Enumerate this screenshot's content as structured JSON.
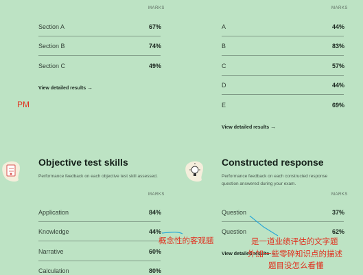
{
  "marks_label": "MARKS",
  "sections_top": {
    "rows": [
      {
        "label": "Section A",
        "value": "67%"
      },
      {
        "label": "Section B",
        "value": "74%"
      },
      {
        "label": "Section C",
        "value": "49%"
      }
    ],
    "link": "View detailed results"
  },
  "letters_top": {
    "rows": [
      {
        "label": "A",
        "value": "44%"
      },
      {
        "label": "B",
        "value": "83%"
      },
      {
        "label": "C",
        "value": "57%"
      },
      {
        "label": "D",
        "value": "44%"
      },
      {
        "label": "E",
        "value": "69%"
      }
    ],
    "link": "View detailed results"
  },
  "objective": {
    "title": "Objective test skills",
    "description": "Performance feedback on each objective test skill assessed.",
    "rows": [
      {
        "label": "Application",
        "value": "84%"
      },
      {
        "label": "Knowledge",
        "value": "44%"
      },
      {
        "label": "Narrative",
        "value": "60%"
      },
      {
        "label": "Calculation",
        "value": "80%"
      }
    ]
  },
  "constructed": {
    "title": "Constructed response",
    "description": "Performance feedback on each constructed response question answered during your exam.",
    "rows": [
      {
        "label": "Question",
        "value": "37%"
      },
      {
        "label": "Question",
        "value": "62%"
      }
    ],
    "link": "View detailed results"
  },
  "annotations": {
    "pm": "PM",
    "left_note": "概念性的客观题",
    "right_line1": "是一道业绩评估的文字题",
    "right_line2": "外加一些零碎知识点的描述",
    "right_line3": "题目没怎么看懂"
  },
  "colors": {
    "background": "#bde3c4",
    "annotation_red": "#e0301e",
    "annotation_line": "#2aa7d6"
  }
}
